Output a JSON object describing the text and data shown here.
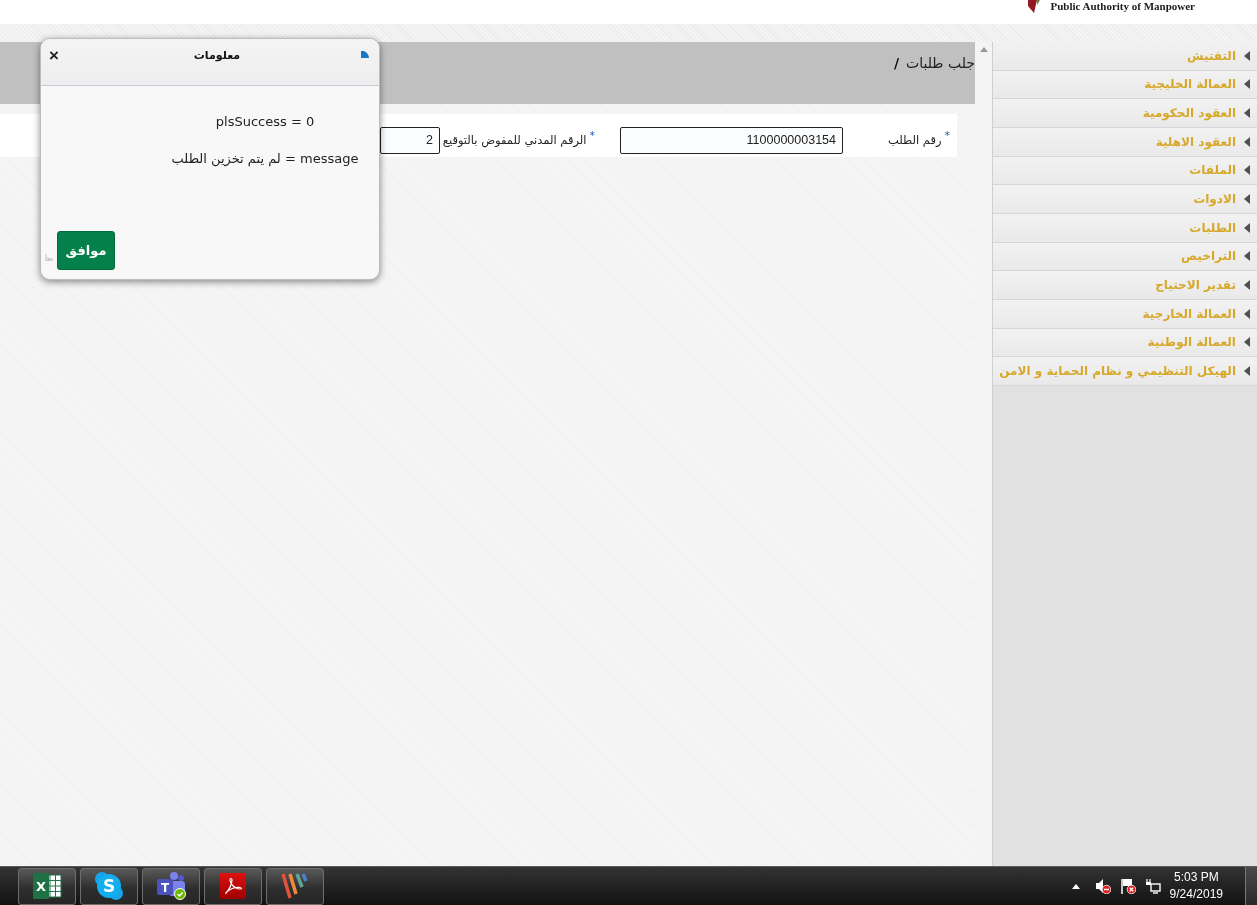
{
  "header": {
    "org_name": "Public Authority of Manpower"
  },
  "page": {
    "title": "جلب طلبات",
    "separator": "/"
  },
  "form": {
    "fields": [
      {
        "label": "رقم الطلب",
        "required_mark": "*",
        "value": "1100000003154"
      },
      {
        "label": "الرقم المدني للمفوض بالتوقيع",
        "required_mark": "*",
        "value": "2"
      }
    ]
  },
  "sidebar": {
    "items": [
      {
        "label": "التفتيش",
        "expanded": false
      },
      {
        "label": "العمالة الخليجية",
        "expanded": false
      },
      {
        "label": "العقود الحكومية",
        "expanded": false
      },
      {
        "label": "العقود الاهلية",
        "expanded": false
      },
      {
        "label": "الملفات",
        "expanded": false
      },
      {
        "label": "الادوات",
        "expanded": false
      },
      {
        "label": "الطلبات",
        "expanded": false
      },
      {
        "label": "التراخيص",
        "expanded": false
      },
      {
        "label": "تقدير الاحتياج",
        "expanded": false
      },
      {
        "label": "العمالة الخارجية",
        "expanded": false
      },
      {
        "label": "العمالة الوطنية",
        "expanded": false
      },
      {
        "label": "الهيكل التنظيمي و نظام الحماية و الامن",
        "expanded": false
      }
    ]
  },
  "dialog": {
    "title": "معلومات",
    "close": "×",
    "lines": [
      "plsSuccess = 0",
      "message = لم يتم تخزين الطلب"
    ],
    "button": "موافق"
  },
  "taskbar": {
    "apps": [
      {
        "kind": "stripes"
      },
      {
        "kind": "pdf"
      },
      {
        "kind": "team",
        "letter": "T"
      },
      {
        "kind": "chat",
        "letter": "S"
      },
      {
        "kind": "spreadsheet",
        "letter": "X"
      }
    ],
    "clock": {
      "time": "5:03 PM",
      "date": "9/24/2019"
    }
  }
}
